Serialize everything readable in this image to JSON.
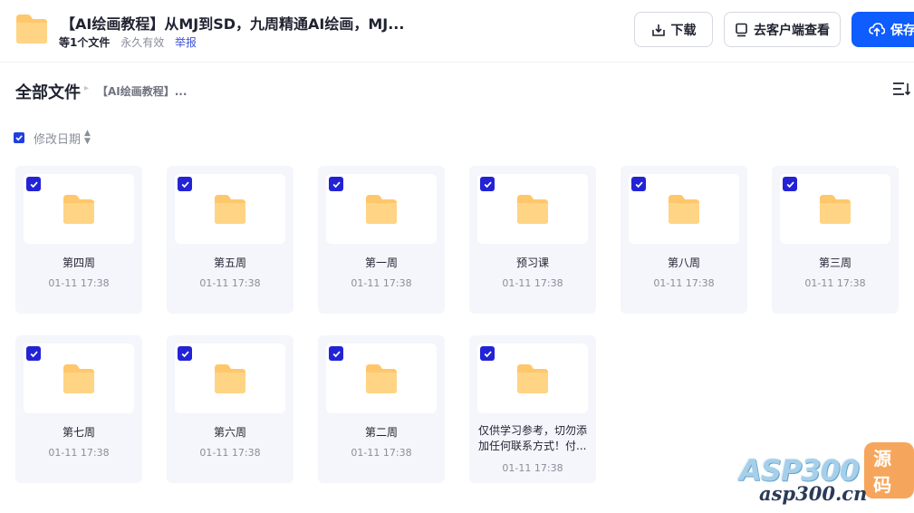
{
  "header": {
    "title": "【AI绘画教程】从MJ到SD，九周精通AI绘画，MJ...",
    "file_count": "等1个文件",
    "validity": "永久有效",
    "report": "举报",
    "buttons": {
      "download": "下载",
      "open_client": "去客户端查看",
      "save": "保存"
    }
  },
  "breadcrumb": {
    "root": "全部文件",
    "current": "【AI绘画教程】..."
  },
  "sort": {
    "label": "修改日期"
  },
  "colors": {
    "accent": "#0f5cff",
    "checkbox": "#2323d6",
    "folder": "#ffc76b",
    "card_bg": "#f5f6fb"
  },
  "files": [
    {
      "name": "第四周",
      "date": "01-11 17:38"
    },
    {
      "name": "第五周",
      "date": "01-11 17:38"
    },
    {
      "name": "第一周",
      "date": "01-11 17:38"
    },
    {
      "name": "预习课",
      "date": "01-11 17:38"
    },
    {
      "name": "第八周",
      "date": "01-11 17:38"
    },
    {
      "name": "第三周",
      "date": "01-11 17:38"
    },
    {
      "name": "第七周",
      "date": "01-11 17:38"
    },
    {
      "name": "第六周",
      "date": "01-11 17:38"
    },
    {
      "name": "第二周",
      "date": "01-11 17:38"
    },
    {
      "name": "仅供学习参考，切勿添加任何联系方式！付...",
      "date": "01-11 17:38"
    }
  ],
  "watermark": {
    "brand": "ASP300",
    "badge": "源码",
    "url": "asp300.cn"
  }
}
